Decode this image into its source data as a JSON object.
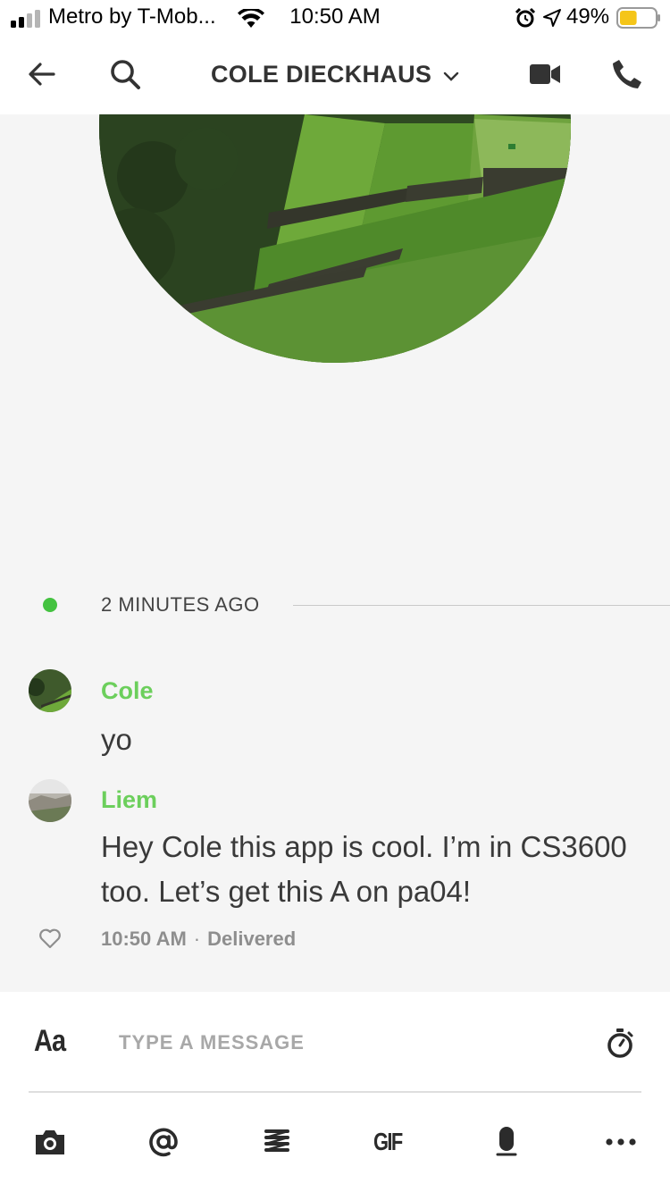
{
  "status_bar": {
    "carrier": "Metro by T-Mob...",
    "time": "10:50 AM",
    "battery_percent": "49%",
    "battery_level": 0.49,
    "icons": [
      "signal-icon",
      "wifi-icon",
      "alarm-icon",
      "location-icon",
      "battery-icon"
    ]
  },
  "header": {
    "title": "COLE DIECKHAUS",
    "icons": [
      "back-arrow-icon",
      "search-icon",
      "chevron-down-icon",
      "video-camera-icon",
      "phone-icon"
    ]
  },
  "timeline": {
    "divider_label": "2 MINUTES AGO",
    "online_color": "#44c240"
  },
  "messages": [
    {
      "sender": "Cole",
      "text": "yo"
    },
    {
      "sender": "Liem",
      "text": "Hey Cole this app is cool. I’m in CS3600 too. Let’s get this A on pa04!"
    }
  ],
  "message_meta": {
    "time": "10:50 AM",
    "separator": "·",
    "status": "Delivered"
  },
  "composer": {
    "font_toggle_label": "Aa",
    "input_placeholder": "TYPE A MESSAGE",
    "toolbar": {
      "gif_label": "GIF",
      "icons": [
        "camera-icon",
        "mention-icon",
        "spring-icon",
        "gif-icon",
        "microphone-icon",
        "more-icon"
      ]
    },
    "timer_icon": "stopwatch-icon"
  },
  "colors": {
    "sender_name": "#6ccf5c",
    "background": "#f5f5f5",
    "text": "#333333"
  }
}
